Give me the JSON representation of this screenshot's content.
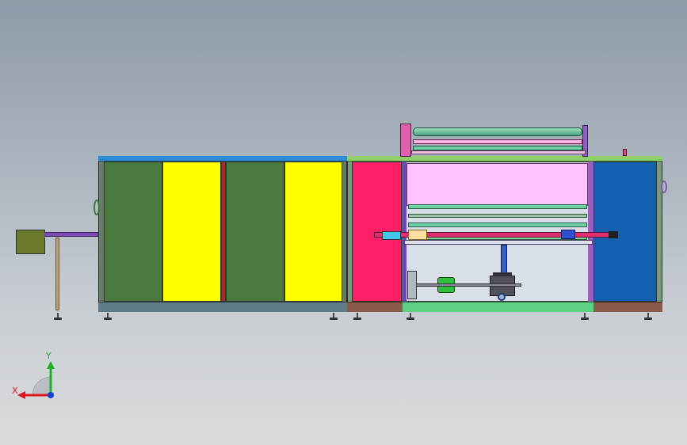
{
  "viewport": {
    "background_top": "#8f9aa8",
    "background_bottom": "#d9dcde"
  },
  "machine": {
    "colors": {
      "left_panel_green": "#4a7a3e",
      "left_panel_yellow": "#ffff00",
      "left_divider_red": "#b02828",
      "right_pink_panel": "#ff1f66",
      "right_blue_panel": "#1560b0",
      "center_window": "#ffc4ff",
      "base_strip": "#5a8a8a",
      "top_frame_blue": "#2e8bd8",
      "roller_green": "#5aae86",
      "motor_box": "#6b7a2a"
    },
    "icons": [
      "coordinate-triad-icon"
    ]
  },
  "triad": {
    "x_label": "X",
    "y_label": "Y",
    "x_color": "#e0161e",
    "y_color": "#1fb01f",
    "z_color": "#1a3fd8"
  }
}
